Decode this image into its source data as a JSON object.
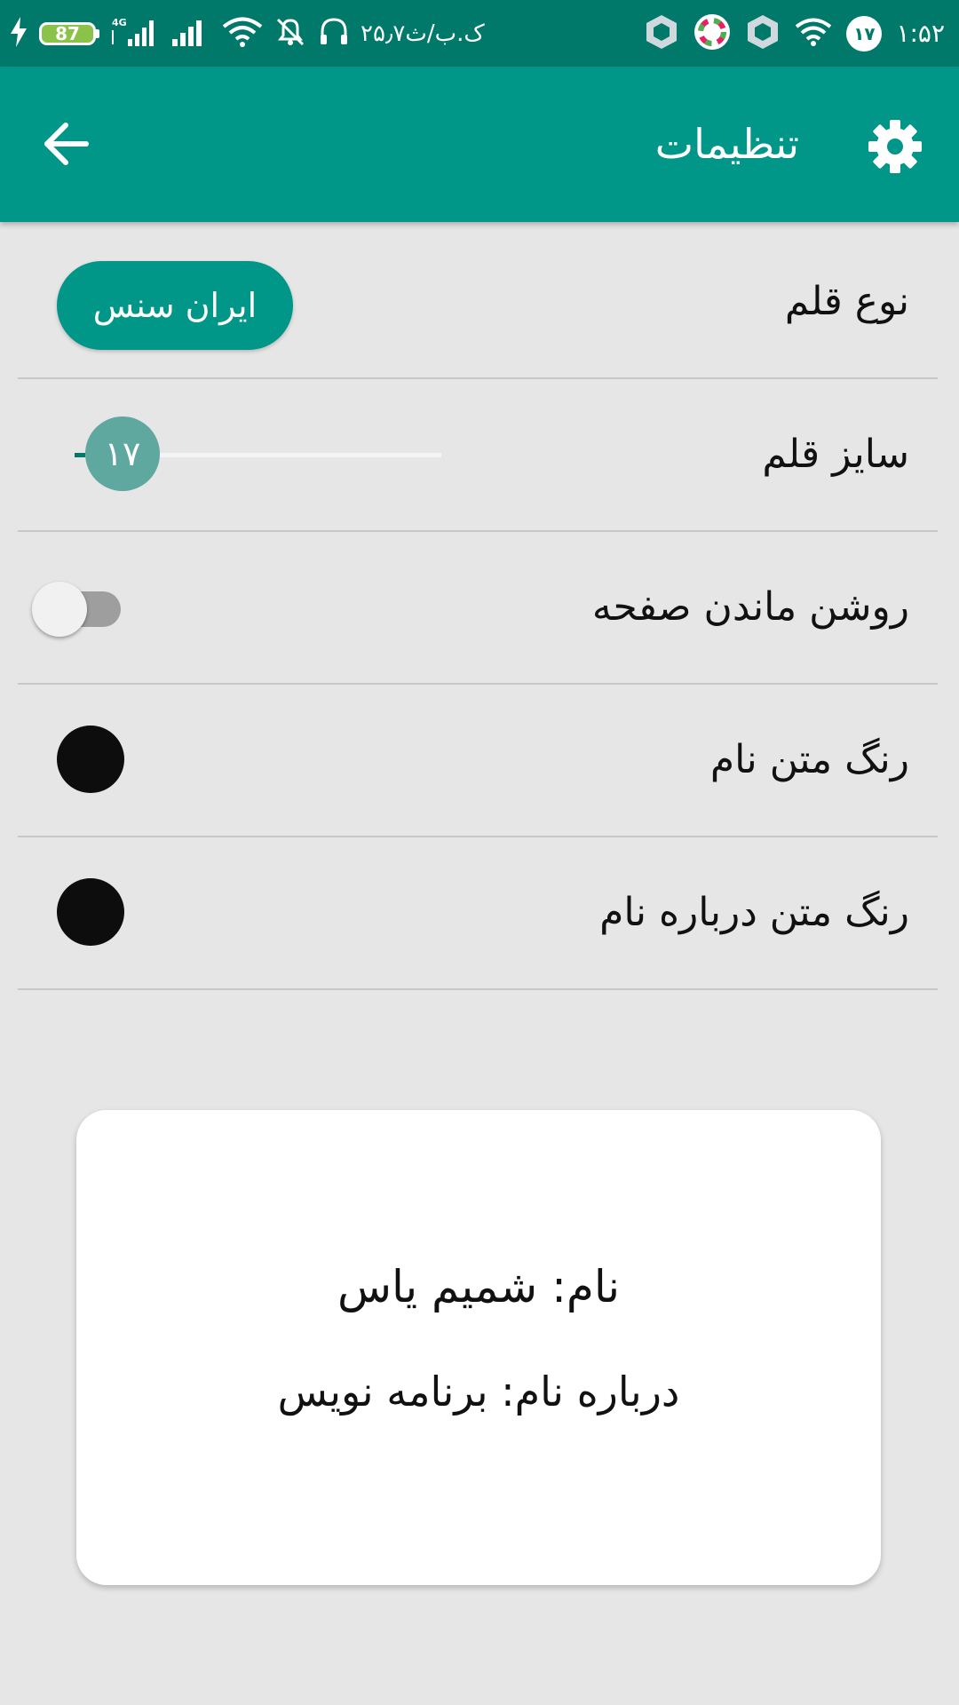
{
  "status_bar": {
    "battery_level": "87",
    "network_label": "4G",
    "speed_text": "۲۵٫۷ک.ب/ث",
    "notification_badge": "۱۷",
    "time": "۱:۵۲"
  },
  "toolbar": {
    "title": "تنظیمات",
    "back_icon": "arrow-left-icon",
    "settings_icon": "gear-icon"
  },
  "settings": {
    "font_type": {
      "label": "نوع قلم",
      "value": "ایران سنس"
    },
    "font_size": {
      "label": "سایز قلم",
      "value": "۱۷",
      "slider_fraction": 0.03
    },
    "keep_screen_on": {
      "label": "روشن ماندن صفحه",
      "enabled": false
    },
    "name_text_color": {
      "label": "رنگ متن نام",
      "color": "#0d0d0d"
    },
    "about_text_color": {
      "label": "رنگ متن درباره نام",
      "color": "#0d0d0d"
    }
  },
  "preview_card": {
    "name_line": "نام: شمیم یاس",
    "about_line": "درباره نام: برنامه نویس"
  },
  "colors": {
    "status_bar": "#00796b",
    "toolbar": "#009688",
    "accent": "#009688",
    "background": "#e6e6e6"
  }
}
